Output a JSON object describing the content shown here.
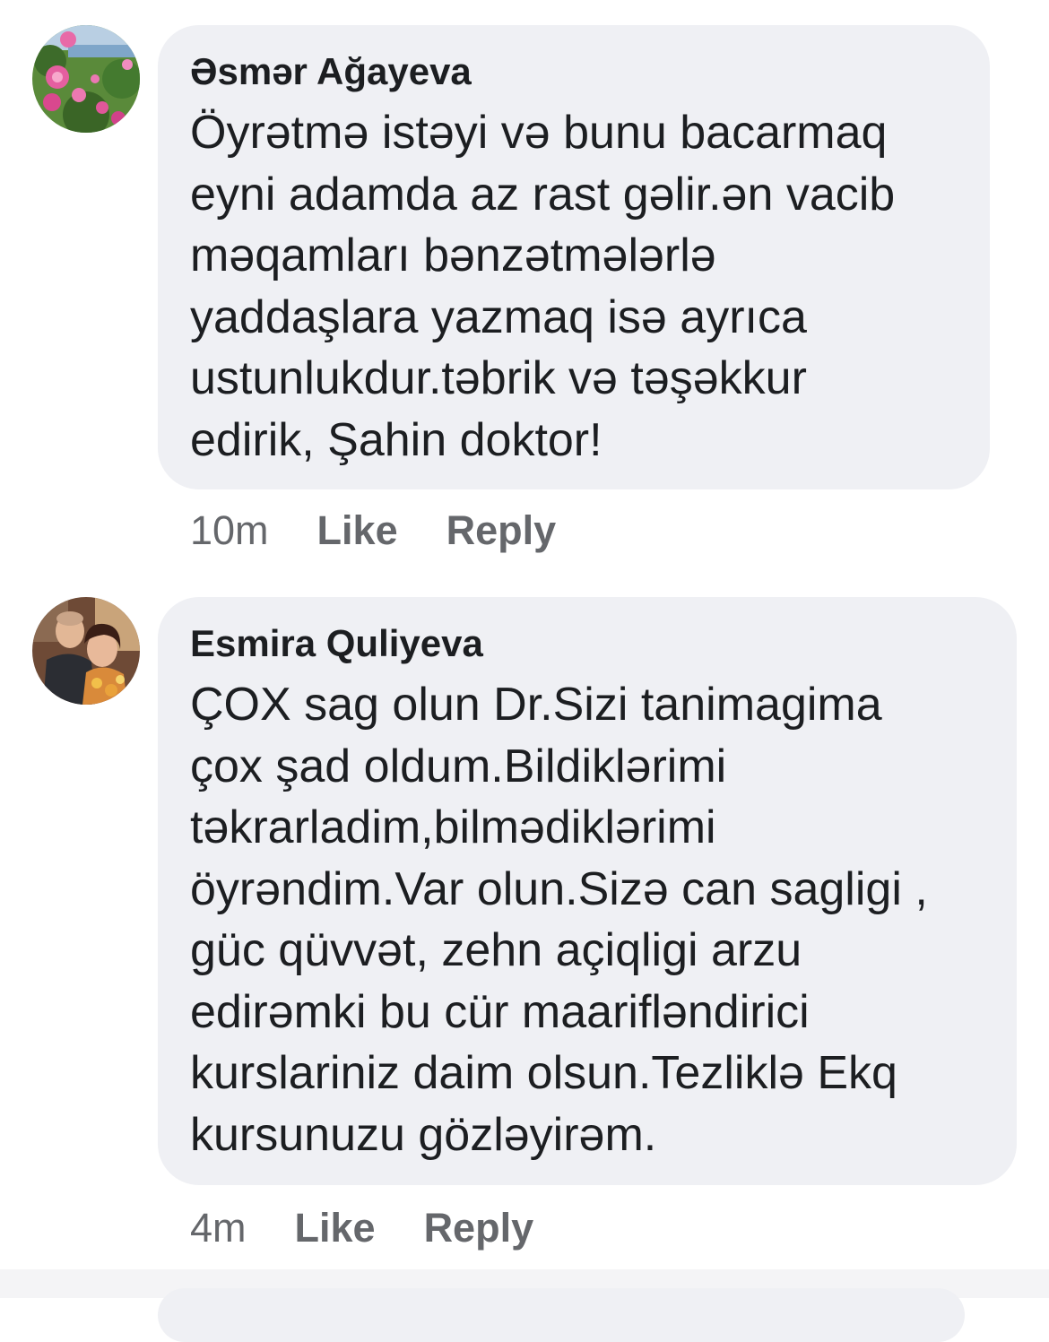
{
  "comments": [
    {
      "author": "Əsmər Ağayeva",
      "text": "Öyrətmə istəyi və bunu bacarmaq\neyni adamda az rast gəlir.ən vacib\nməqamları bənzətmələrlə\nyaddaşlara yazmaq isə ayrıca\nustunlukdur.təbrik və təşəkkur\nedirik, Şahin doktor!",
      "time": "10m",
      "like_label": "Like",
      "reply_label": "Reply",
      "avatar_icon": "roses-photo-icon"
    },
    {
      "author": "Esmira Quliyeva",
      "text": "ÇOX sag olun Dr.Sizi tanimagima\nçox şad oldum.Bildiklərimi\ntəkrarladim,bilmədiklərimi\nöyrəndim.Var olun.Sizə can sagligi ,\ngüc  qüvvət, zehn açiqligi arzu\nedirəmki bu cür maarifləndirici\nkurslariniz daim olsun.Tezliklə Ekq\nkursunuzu gözləyirəm.",
      "time": "4m",
      "like_label": "Like",
      "reply_label": "Reply",
      "avatar_icon": "couple-photo-icon"
    }
  ],
  "colors": {
    "bubble": "#eff0f4",
    "text": "#1c1e21",
    "meta": "#65676b"
  }
}
